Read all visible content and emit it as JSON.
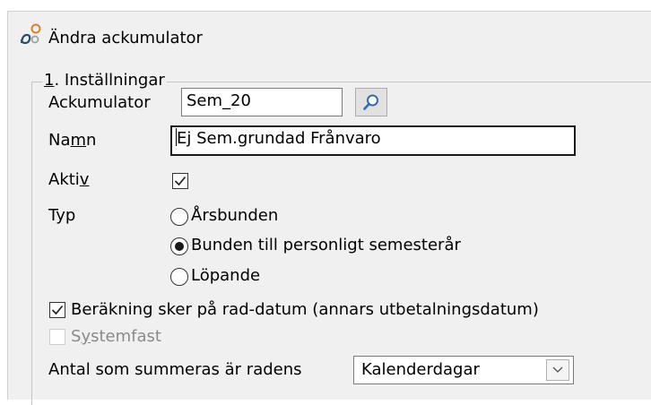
{
  "window": {
    "title": "Ändra ackumulator",
    "icon": "accumulator-icon"
  },
  "group": {
    "legend_prefix": "1",
    "legend_rest": ". Inställningar"
  },
  "fields": {
    "ackumulator": {
      "label": "Ackumulator",
      "value": "Sem_20",
      "search_icon": "search-icon"
    },
    "namn": {
      "label_a": "Na",
      "label_u": "m",
      "label_b": "n",
      "value": "Ej Sem.grundad Frånvaro"
    },
    "aktiv": {
      "label_a": "Akti",
      "label_u": "v",
      "checked": true
    },
    "typ": {
      "label": "Typ",
      "options": [
        {
          "label": "Årsbunden",
          "selected": false
        },
        {
          "label": "Bunden till personligt semesterår",
          "selected": true
        },
        {
          "label": "Löpande",
          "selected": false
        }
      ]
    },
    "berakning": {
      "label": "Beräkning sker på rad-datum (annars utbetalningsdatum)",
      "checked": true
    },
    "systemfast": {
      "label_a": "S",
      "label_u": "y",
      "label_b": "stemfast",
      "checked": false,
      "enabled": false
    },
    "antal": {
      "label": "Antal som summeras är radens",
      "value": "Kalenderdagar"
    }
  }
}
